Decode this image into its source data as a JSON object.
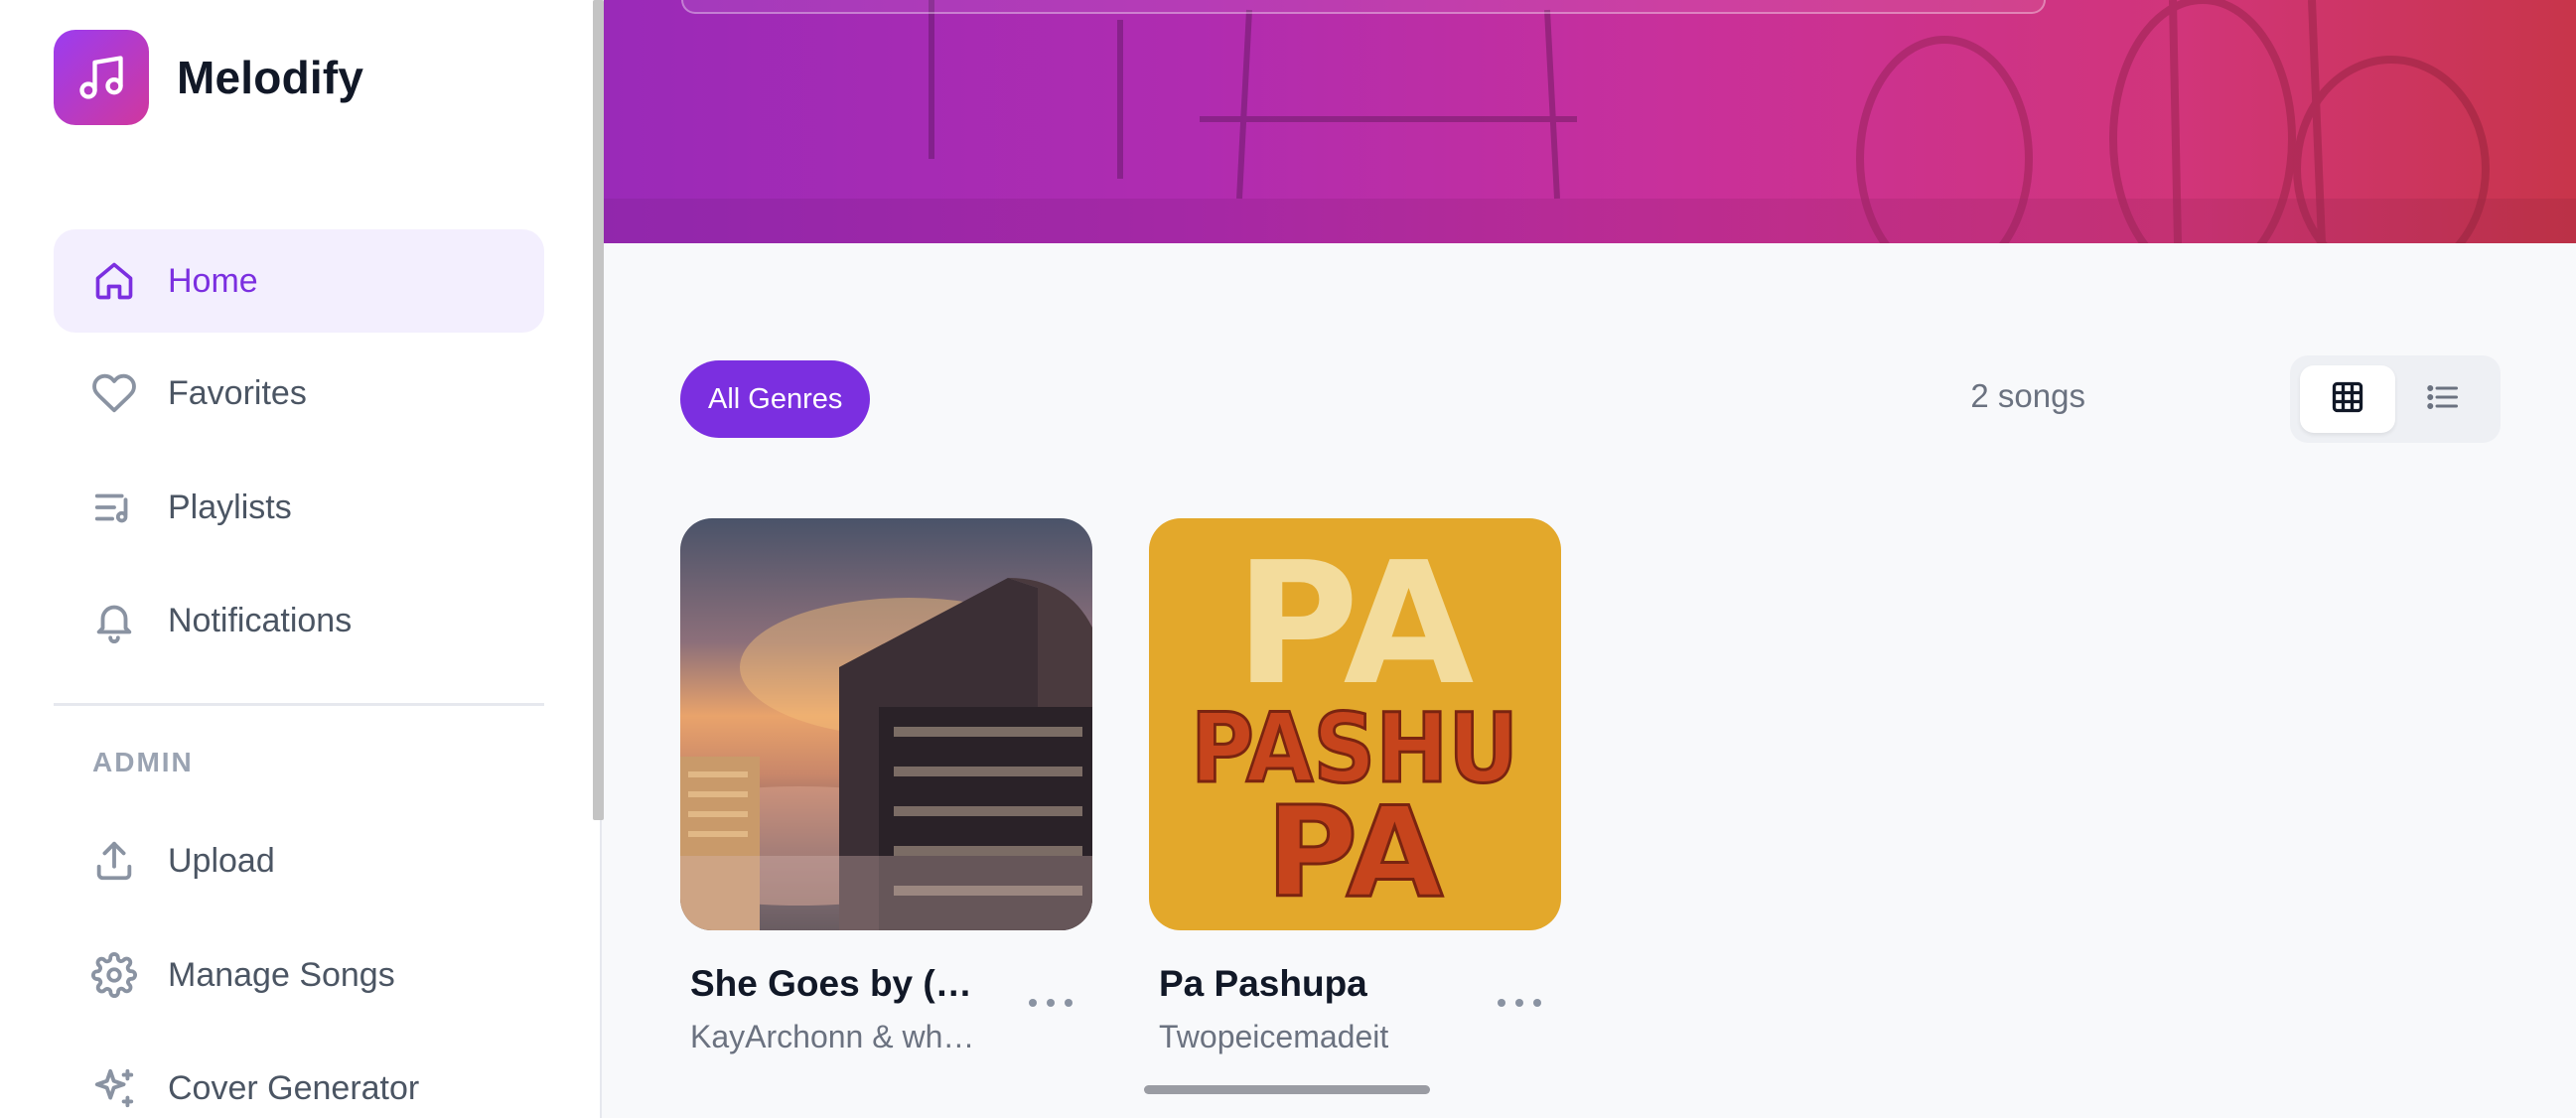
{
  "app": {
    "name": "Melodify",
    "logo_icon": "music-note-icon"
  },
  "sidebar": {
    "items": [
      {
        "label": "Home",
        "icon": "home-icon",
        "active": true
      },
      {
        "label": "Favorites",
        "icon": "heart-icon",
        "active": false
      },
      {
        "label": "Playlists",
        "icon": "playlist-icon",
        "active": false
      },
      {
        "label": "Notifications",
        "icon": "bell-icon",
        "active": false
      }
    ],
    "admin_label": "ADMIN",
    "admin_items": [
      {
        "label": "Upload",
        "icon": "upload-icon"
      },
      {
        "label": "Manage Songs",
        "icon": "gear-icon"
      },
      {
        "label": "Cover Generator",
        "icon": "sparkle-icon"
      }
    ]
  },
  "filters": {
    "genre_label": "All Genres",
    "count_label": "2 songs",
    "view_mode": "grid"
  },
  "songs": [
    {
      "title": "She Goes by (K…",
      "artist": "KayArchonn & whe…",
      "cover": "city-sunset-cover"
    },
    {
      "title": "Pa Pashupa",
      "artist": "Twopeicemadeit",
      "cover": "pa-pashupa-cover",
      "cover_text": [
        "PA",
        "PASHU",
        "PA"
      ]
    }
  ],
  "colors": {
    "accent": "#7b2fe0",
    "active_bg": "#f3effe",
    "cover_b": "#e3a82b"
  }
}
